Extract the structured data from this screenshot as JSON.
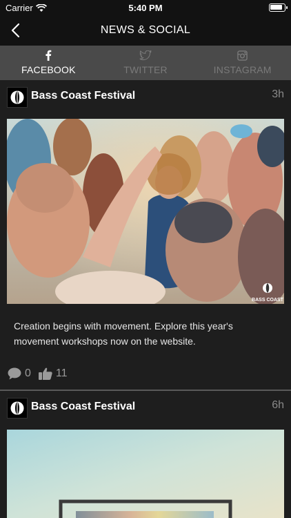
{
  "status_bar": {
    "carrier": "Carrier",
    "time": "5:40 PM"
  },
  "nav": {
    "title": "NEWS & SOCIAL"
  },
  "tabs": [
    {
      "label": "FACEBOOK",
      "icon": "facebook-icon",
      "active": true
    },
    {
      "label": "TWITTER",
      "icon": "twitter-icon",
      "active": false
    },
    {
      "label": "INSTAGRAM",
      "icon": "instagram-icon",
      "active": false
    }
  ],
  "posts": [
    {
      "author": "Bass Coast Festival",
      "time_ago": "3h",
      "image_watermark": "BASS COAST",
      "text": "Creation begins with movement. Explore this year's movement workshops now on the website.",
      "comments": "0",
      "likes": "11"
    },
    {
      "author": "Bass Coast Festival",
      "time_ago": "6h"
    }
  ],
  "colors": {
    "background": "#1e1e1e",
    "bar": "#121212",
    "tab_bar": "#4a4a4a",
    "inactive_tab": "#7a7a7a",
    "muted_text": "#8a8a8a"
  }
}
